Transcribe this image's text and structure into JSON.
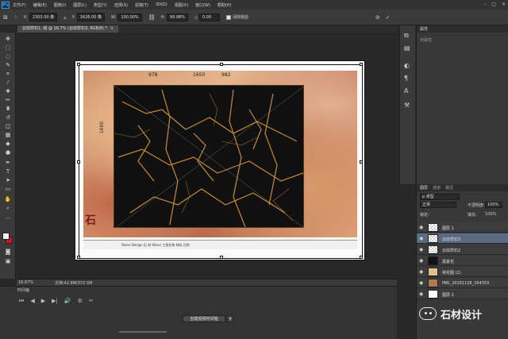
{
  "menubar": {
    "logo": "Ps",
    "items": [
      "文件(F)",
      "编辑(E)",
      "图像(I)",
      "图层(L)",
      "类型(Y)",
      "选择(S)",
      "滤镜(T)",
      "3D(D)",
      "视图(V)",
      "窗口(W)",
      "帮助(H)"
    ],
    "window_controls": [
      "–",
      "□",
      "✕"
    ]
  },
  "options_bar": {
    "x_label": "X:",
    "x_value": "2303.00 像",
    "y_label": "Y:",
    "y_value": "1626.00 像",
    "w_label": "W:",
    "w_value": "100.00%",
    "h_label": "H:",
    "h_value": "99.98%",
    "angle_label": "△",
    "angle_value": "0.00",
    "antialias_label": "消除锯齿",
    "cancel_icon": "⊘",
    "commit_icon": "✓"
  },
  "document_tab": {
    "title": "云纹样石1, 组 @ 16.7% (云纹样石3, RGB/8) *",
    "close": "×"
  },
  "canvas": {
    "dimensions": [
      "978",
      "1650",
      "982",
      "1600"
    ],
    "footer_text": "Stone Design  石  材  Stone    工程名称   材料  比例",
    "logo_glyph": "石"
  },
  "status": {
    "zoom": "16.67%",
    "doc_size": "文档:42.8M/372.5M"
  },
  "timeline": {
    "title": "时间轴",
    "controls": [
      "⏮",
      "◀",
      "▶",
      "▶|",
      "🔊",
      "⚙",
      "✂"
    ],
    "create_button": "创建视频时间轴",
    "dropdown": "▾"
  },
  "properties": {
    "title": "属性",
    "empty_text": "无属性"
  },
  "layers_panel": {
    "tabs": [
      "图层",
      "通道",
      "路径"
    ],
    "filter_label": "ρ 类型",
    "blend_mode": "正常",
    "opacity_label": "不透明度:",
    "opacity_value": "100%",
    "lock_label": "锁定:",
    "fill_label": "填充:",
    "fill_value": "100%",
    "layers": [
      {
        "name": "图层 1",
        "thumb": "checker",
        "selected": false
      },
      {
        "name": "云纹样石3",
        "thumb": "checker",
        "selected": true
      },
      {
        "name": "云纹样石2",
        "thumb": "checker",
        "selected": false
      },
      {
        "name": "黑金花",
        "thumb": "slab",
        "selected": false
      },
      {
        "name": "荷花图 (2)",
        "thumb": "frame",
        "selected": false
      },
      {
        "name": "IMG_20161126_164353",
        "thumb": "photo",
        "selected": false
      },
      {
        "name": "图层 2",
        "thumb": "white",
        "selected": false
      }
    ]
  },
  "watermark": {
    "text": "石材设计"
  }
}
